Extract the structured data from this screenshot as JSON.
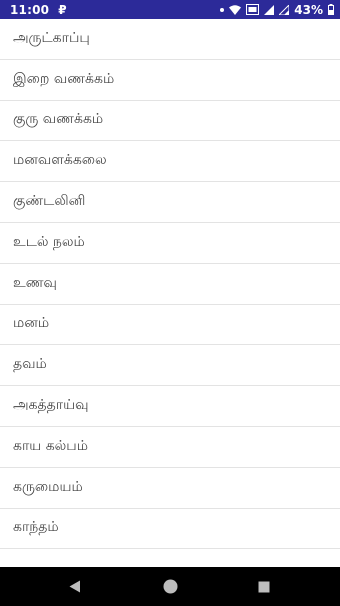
{
  "status_bar": {
    "time": "11:00",
    "app_notification_glyph": "₽",
    "battery_percent": "43%"
  },
  "menu": {
    "items": [
      "அருட்காப்பு",
      "இறை வணக்கம்",
      "குரு வணக்கம்",
      "மனவளக்கலை",
      "குண்டலினி",
      "உடல் நலம்",
      "உணவு",
      "மனம்",
      "தவம்",
      "அகத்தாய்வு",
      "காய கல்பம்",
      "கருமையம்",
      "காந்தம்",
      "...."
    ]
  },
  "colors": {
    "status_bar": "#2c2a99",
    "nav_bar": "#000000",
    "divider": "#e3e3e3",
    "text": "#444444"
  },
  "icons": {
    "back": "back-triangle-icon",
    "home": "home-circle-icon",
    "recents": "recents-square-icon"
  }
}
